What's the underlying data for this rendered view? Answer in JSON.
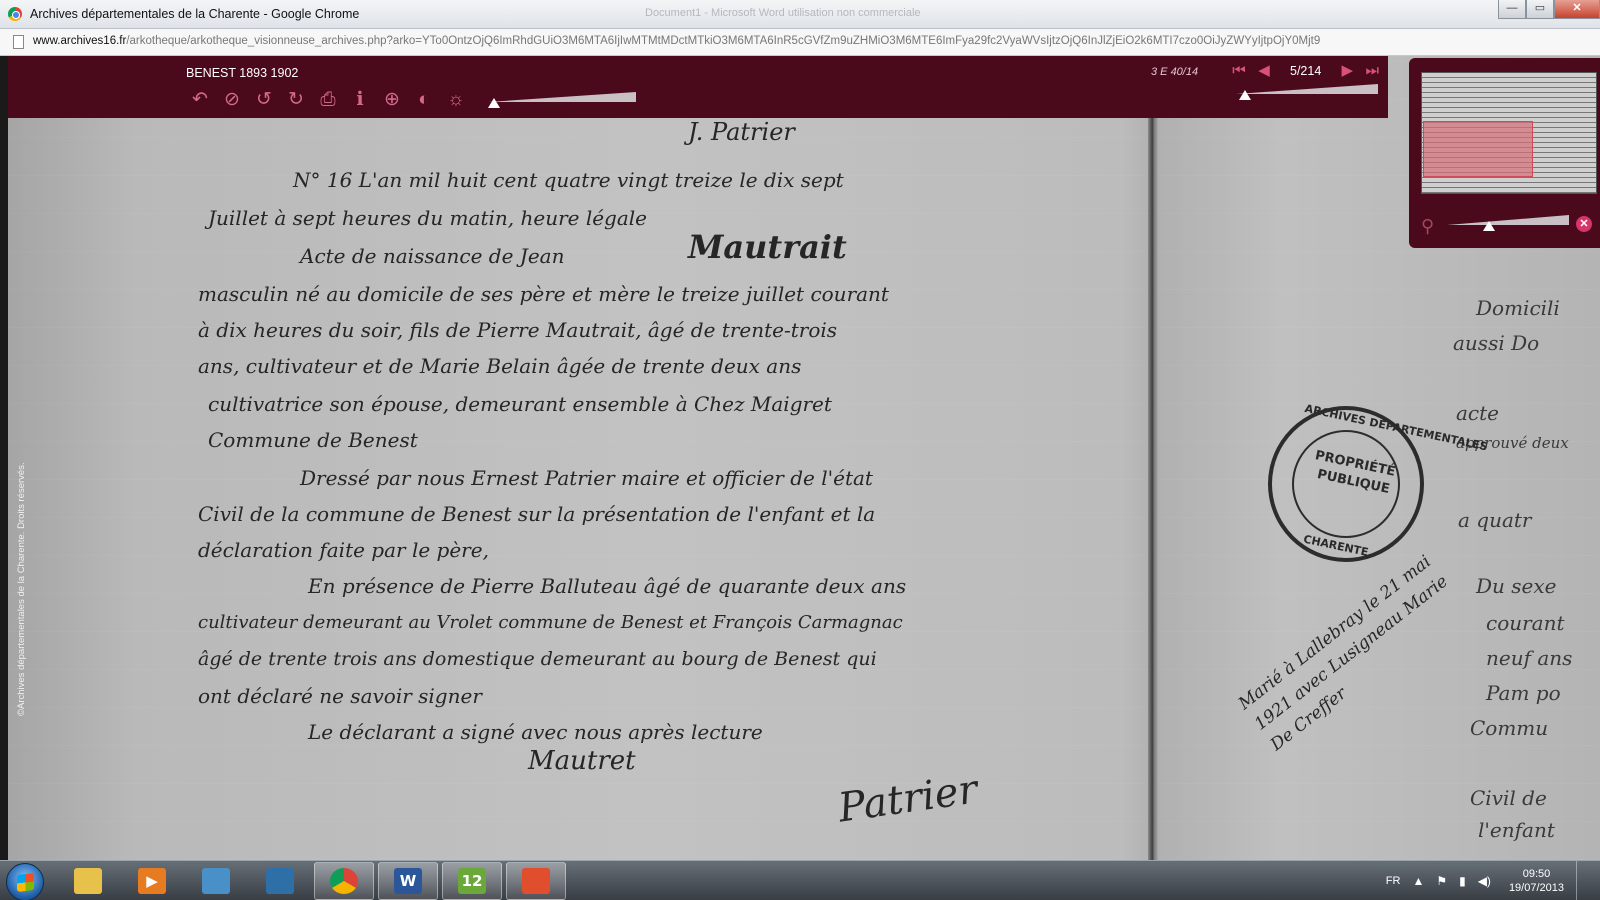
{
  "window": {
    "title": "Archives départementales de la Charente - Google Chrome",
    "background_title": "Document1 - Microsoft Word utilisation non commerciale",
    "minimize": "—",
    "maximize": "▭",
    "close": "✕"
  },
  "address": {
    "domain": "www.archives16.fr",
    "path": "/arkotheque/arkotheque_visionneuse_archives.php?arko=YTo0OntzOjQ6ImRhdGUiO3M6MTA6IjIwMTMtMDctMTkiO3M6MTA6InR5cGVfZm9uZHMiO3M6MTE6ImFya29fc2VyaWVsIjtzOjQ6InJlZjEiO2k6MTI7czo0OiJyZWYyIjtpOjY0Mjt9"
  },
  "viewer": {
    "document_title": "BENEST 1893 1902",
    "cote": "3 E 40/14",
    "page": "5/214",
    "copyright": "©Archives départementales de la Charente. Droits réservés.",
    "tools": [
      {
        "name": "undo-icon",
        "glyph": "↶"
      },
      {
        "name": "no-icon",
        "glyph": "⊘"
      },
      {
        "name": "rotate-left-icon",
        "glyph": "↺"
      },
      {
        "name": "rotate-right-icon",
        "glyph": "↻"
      },
      {
        "name": "print-icon",
        "glyph": "⎙"
      },
      {
        "name": "info-icon",
        "glyph": "ℹ"
      },
      {
        "name": "lock-icon",
        "glyph": "⊕"
      },
      {
        "name": "contrast-icon",
        "glyph": "◐"
      },
      {
        "name": "brightness-icon",
        "glyph": "☼"
      }
    ],
    "nav": {
      "first": "⏮",
      "prev": "◀",
      "next": "▶",
      "last": "⏭"
    },
    "brightness_level": 0,
    "page_slider_level": 0.02,
    "zoom_level": 0.33,
    "thumb_close": "✕",
    "zoom_icon": "⚲"
  },
  "document": {
    "header_scrawl": "J. Patrier",
    "lines": [
      "N° 16   L'an mil huit cent quatre vingt treize le dix sept",
      "Juillet à sept heures du matin, heure légale",
      "Acte de naissance de  Jean",
      "masculin né au domicile de ses père et mère le treize juillet courant",
      "à dix heures du soir, fils de Pierre Mautrait, âgé de trente-trois",
      "ans, cultivateur et de Marie Belain âgée de trente deux ans",
      "cultivatrice son épouse, demeurant ensemble à Chez Maigret",
      "Commune de Benest",
      "Dressé par nous Ernest Patrier maire et officier de l'état",
      "Civil de la commune de Benest sur la présentation de l'enfant et la",
      "déclaration faite par le père,",
      "En présence de Pierre Balluteau âgé de quarante deux ans",
      "cultivateur demeurant au Vrolet commune de Benest et François Carmagnac",
      "âgé de trente trois ans domestique demeurant au bourg de Benest qui",
      "ont déclaré ne savoir signer",
      "Le déclarant a signé avec nous après lecture"
    ],
    "surname": "Mautrait",
    "signature_left": "Mautret",
    "signature_right": "Patrier",
    "margin_note": "Marié à Lallebray le 21 mai 1921 avec Lusigneau Marie  De Creffer",
    "right_page_fragments": [
      "Domicili",
      "aussi Do",
      "acte",
      "approuvé deux",
      "a quatr",
      "Du sexe",
      "courant",
      "neuf ans",
      "Pam po",
      "Commu",
      "Civil de",
      "l'enfant"
    ],
    "stamp": {
      "outer": "ARCHIVES DÉPARTEMENTALES",
      "line1": "PROPRIÉTÉ",
      "line2": "PUBLIQUE",
      "bottom": "CHARENTE"
    }
  },
  "taskbar": {
    "items": [
      {
        "name": "explorer-icon",
        "label": "",
        "color": "#e7c14a"
      },
      {
        "name": "media-player-icon",
        "label": "▶",
        "color": "#e77b22"
      },
      {
        "name": "photo-viewer-icon",
        "label": "",
        "color": "#4a90c8"
      },
      {
        "name": "computer-icon",
        "label": "",
        "color": "#2f6fa8"
      },
      {
        "name": "chrome-icon",
        "label": "",
        "color": "#db4437"
      },
      {
        "name": "word-icon",
        "label": "W",
        "color": "#2b579a"
      },
      {
        "name": "app-12-icon",
        "label": "12",
        "color": "#6aa83a"
      },
      {
        "name": "film-icon",
        "label": "",
        "color": "#e04e2e"
      }
    ],
    "language": "FR",
    "time": "09:50",
    "date": "19/07/2013"
  }
}
